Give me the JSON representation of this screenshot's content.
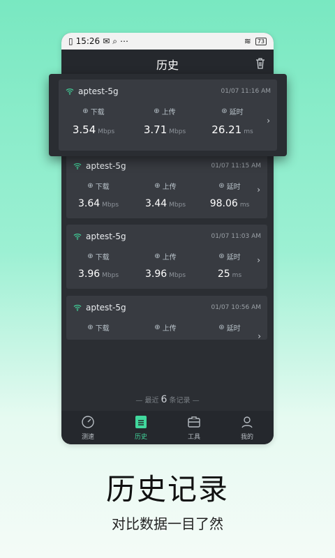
{
  "status": {
    "time": "15:26",
    "battery": "73"
  },
  "header": {
    "title": "历史"
  },
  "labels": {
    "download": "下载",
    "upload": "上传",
    "latency": "延时",
    "mbps": "Mbps",
    "ms": "ms"
  },
  "records": [
    {
      "ssid": "aptest-5g",
      "time": "01/07 11:16 AM",
      "download": "3.54",
      "upload": "3.71",
      "latency": "26.21"
    },
    {
      "ssid": "aptest-5g",
      "time": "01/07 11:15 AM",
      "download": "3.64",
      "upload": "3.44",
      "latency": "98.06"
    },
    {
      "ssid": "aptest-5g",
      "time": "01/07 11:03 AM",
      "download": "3.96",
      "upload": "3.96",
      "latency": "25"
    },
    {
      "ssid": "aptest-5g",
      "time": "01/07 10:56 AM",
      "download": "",
      "upload": "",
      "latency": ""
    }
  ],
  "footer": {
    "prefix": "— 最近",
    "count": "6",
    "suffix": "条记录 —"
  },
  "tabs": [
    {
      "label": "测速",
      "active": false
    },
    {
      "label": "历史",
      "active": true
    },
    {
      "label": "工具",
      "active": false
    },
    {
      "label": "我的",
      "active": false
    }
  ],
  "promo": {
    "title": "历史记录",
    "subtitle": "对比数据一目了然"
  },
  "colors": {
    "accent": "#41d89d",
    "card": "#383b41",
    "panel": "#2b2e33"
  }
}
